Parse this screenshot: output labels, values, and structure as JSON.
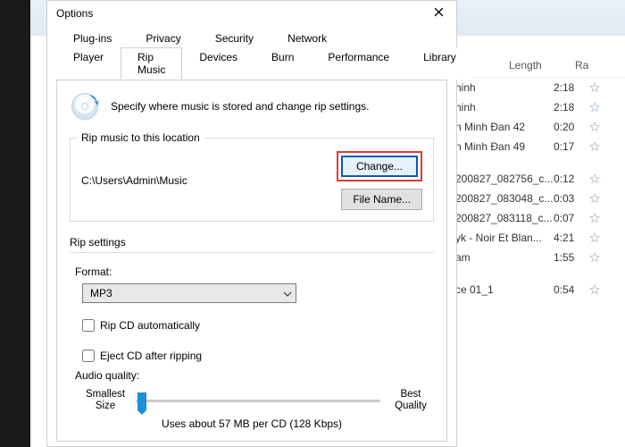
{
  "dialog": {
    "title": "Options",
    "tabs_top": [
      "Plug-ins",
      "Privacy",
      "Security",
      "Network"
    ],
    "tabs_bottom": [
      "Player",
      "Rip Music",
      "Devices",
      "Burn",
      "Performance",
      "Library"
    ],
    "active_tab": "Rip Music",
    "intro": "Specify where music is stored and change rip settings.",
    "location": {
      "group_title": "Rip music to this location",
      "path": "C:\\Users\\Admin\\Music",
      "change_label": "Change...",
      "file_name_label": "File Name..."
    },
    "settings": {
      "group_title": "Rip settings",
      "format_label": "Format:",
      "format_value": "MP3",
      "checkbox1": "Rip CD automatically",
      "checkbox2": "Eject CD after ripping",
      "audio_quality_label": "Audio quality:",
      "slider_min_label1": "Smallest",
      "slider_min_label2": "Size",
      "slider_max_label1": "Best",
      "slider_max_label2": "Quality",
      "slider_info": "Uses about 57 MB per CD (128 Kbps)"
    }
  },
  "background": {
    "cols": {
      "length": "Length",
      "rating": "Ra"
    },
    "rows": [
      {
        "title": "hinh",
        "len": "2:18"
      },
      {
        "title": "hinh",
        "len": "2:18"
      },
      {
        "title": "n Minh Đan 42",
        "len": "0:20"
      },
      {
        "title": "n Minh Đan 49",
        "len": "0:17"
      },
      {
        "title": "",
        "len": ""
      },
      {
        "title": "200827_082756_c...",
        "len": "0:12"
      },
      {
        "title": "200827_083048_c...",
        "len": "0:03"
      },
      {
        "title": "200827_083118_c...",
        "len": "0:07"
      },
      {
        "title": "yk - Noir Et Blan...",
        "len": "4:21"
      },
      {
        "title": "am",
        "len": "1:55"
      },
      {
        "title": "",
        "len": ""
      },
      {
        "title": "ce 01_1",
        "len": "0:54"
      }
    ]
  }
}
